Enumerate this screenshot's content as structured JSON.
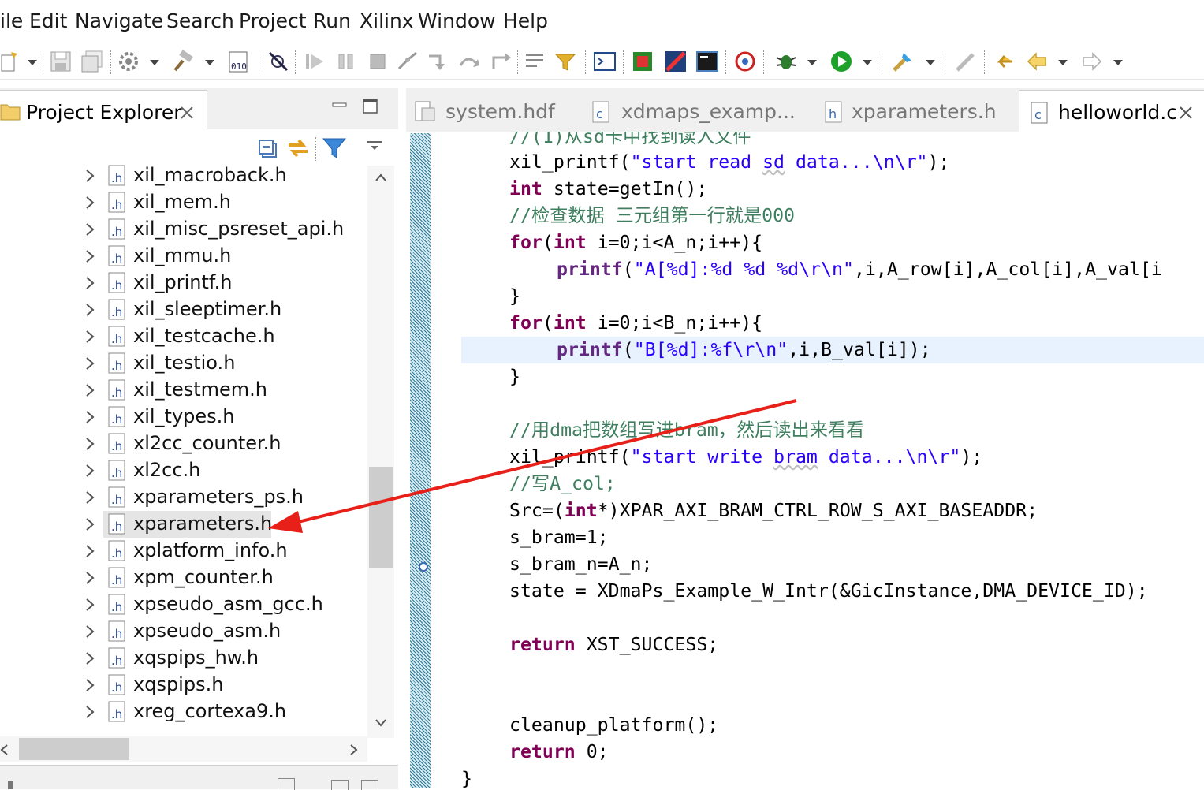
{
  "menu": {
    "items": [
      "ile",
      "Edit",
      "Navigate",
      "Search",
      "Project",
      "Run",
      "Xilinx",
      "Window",
      "Help"
    ]
  },
  "toolbar": {
    "icons": [
      "new-icon",
      "save-icon",
      "save-all-icon",
      "build-settings-icon",
      "build-icon",
      "binary-icon",
      "skip-breakpoints-icon",
      "resume-icon",
      "suspend-icon",
      "terminate-icon",
      "disconnect-icon",
      "step-into-icon",
      "step-over-icon",
      "step-return-icon",
      "drop-to-frame-icon",
      "use-step-filters-icon",
      "xsct-console-icon",
      "program-fpga-icon",
      "program-flash-icon",
      "terminal-icon",
      "launch-icon",
      "debug-icon",
      "run-icon",
      "external-tools-icon",
      "pen-icon",
      "back-icon",
      "forward-icon"
    ]
  },
  "explorer": {
    "title": "Project Explorer",
    "items": [
      "xil_macroback.h",
      "xil_mem.h",
      "xil_misc_psreset_api.h",
      "xil_mmu.h",
      "xil_printf.h",
      "xil_sleeptimer.h",
      "xil_testcache.h",
      "xil_testio.h",
      "xil_testmem.h",
      "xil_types.h",
      "xl2cc_counter.h",
      "xl2cc.h",
      "xparameters_ps.h",
      "xparameters.h",
      "xplatform_info.h",
      "xpm_counter.h",
      "xpseudo_asm_gcc.h",
      "xpseudo_asm.h",
      "xqspips_hw.h",
      "xqspips.h",
      "xreg_cortexa9.h"
    ],
    "selected": "xparameters.h"
  },
  "editor": {
    "tabs": [
      {
        "label": "system.hdf",
        "icon": "hdf-file-icon"
      },
      {
        "label": "xdmaps_examp...",
        "icon": "c-file-icon"
      },
      {
        "label": "xparameters.h",
        "icon": "h-file-icon"
      },
      {
        "label": "helloworld.c",
        "icon": "c-file-icon",
        "active": true
      }
    ],
    "code": {
      "l0": "//(1)从sd卡中找到读入文件",
      "l1a": "xil_printf(",
      "l1b": "\"start read ",
      "l1c": "sd",
      "l1d": " data...\\n\\r\"",
      "l1e": ");",
      "l2a": "int",
      "l2b": " state=getIn();",
      "l3": "//检查数据 三元组第一行就是000",
      "l4a": "for",
      "l4b": "(",
      "l4c": "int",
      "l4d": " i=0;i<A_n;i++){",
      "l5a": "printf",
      "l5b": "(",
      "l5c": "\"A[%d]:%d %d %d\\r\\n\"",
      "l5d": ",i,A_row[i],A_col[i],A_val[i",
      "l6": "}",
      "l7a": "for",
      "l7b": "(",
      "l7c": "int",
      "l7d": " i=0;i<B_n;i++){",
      "l8a": "printf",
      "l8b": "(",
      "l8c": "\"B[%d]:%f\\r\\n\"",
      "l8d": ",i,B_val[i]);",
      "l9": "}",
      "l10": "//用dma把数组写进bram，然后读出来看看",
      "l11a": "xil_printf(",
      "l11b": "\"start write ",
      "l11c": "bram",
      "l11d": " data...\\n\\r\"",
      "l11e": ");",
      "l12": "//写A_col;",
      "l13a": "Src=(",
      "l13b": "int",
      "l13c": "*)XPAR_AXI_BRAM_CTRL_ROW_S_AXI_BASEADDR;",
      "l14": "s_bram=1;",
      "l15": "s_bram_n=A_n;",
      "l16": "state = XDmaPs_Example_W_Intr(&GicInstance,DMA_DEVICE_ID);",
      "l17a": "return",
      "l17b": " XST_SUCCESS;",
      "l18": "cleanup_platform();",
      "l19a": "return",
      "l19b": " 0;",
      "l20": "}"
    }
  },
  "annotation": {
    "type": "red-arrow",
    "color": "#e8201a"
  }
}
